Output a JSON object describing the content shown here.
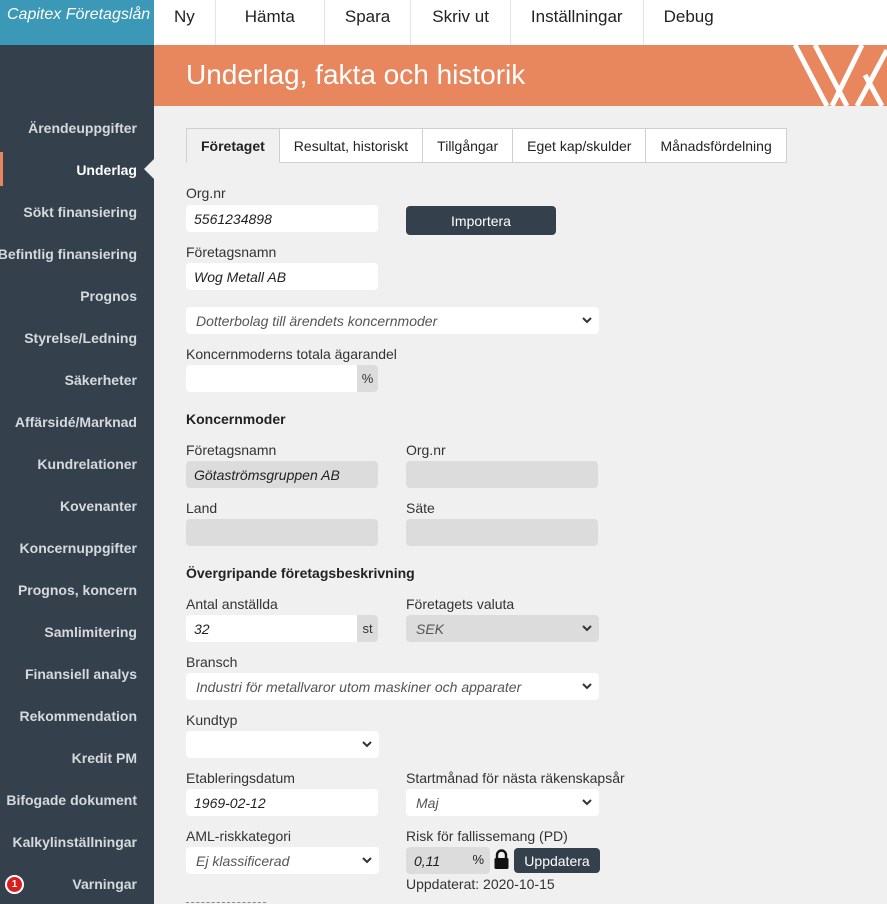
{
  "app": {
    "title": "Capitex Företagslån"
  },
  "topnav": [
    "Ny",
    "Hämta",
    "Spara",
    "Skriv ut",
    "Inställningar",
    "Debug"
  ],
  "sidebar": {
    "items": [
      "Ärendeuppgifter",
      "Underlag",
      "Sökt finansiering",
      "Befintlig finansiering",
      "Prognos",
      "Styrelse/Ledning",
      "Säkerheter",
      "Affärsidé/Marknad",
      "Kundrelationer",
      "Kovenanter",
      "Koncernuppgifter",
      "Prognos, koncern",
      "Samlimitering",
      "Finansiell analys",
      "Rekommendation",
      "Kredit PM",
      "Bifogade dokument",
      "Kalkylinställningar",
      "Varningar"
    ],
    "active": "Underlag",
    "warnings_count": "1"
  },
  "header": {
    "title": "Underlag, fakta och historik"
  },
  "tabs": [
    "Företaget",
    "Resultat, historiskt",
    "Tillgångar",
    "Eget kap/skulder",
    "Månadsfördelning"
  ],
  "form": {
    "orgnr_label": "Org.nr",
    "orgnr_value": "5561234898",
    "import_button": "Importera",
    "company_name_label": "Företagsnamn",
    "company_name_value": "Wog Metall AB",
    "relation_select": "Dotterbolag till ärendets koncernmoder",
    "parent_share_label": "Koncernmoderns totala ägarandel",
    "parent_share_value": "",
    "percent_unit": "%",
    "parent_section": "Koncernmoder",
    "parent_name_label": "Företagsnamn",
    "parent_name_value": "Götaströmsgruppen AB",
    "parent_orgnr_label": "Org.nr",
    "parent_orgnr_value": "",
    "country_label": "Land",
    "country_value": "",
    "seat_label": "Säte",
    "seat_value": "",
    "overview_section": "Övergripande företagsbeskrivning",
    "employees_label": "Antal anställda",
    "employees_value": "32",
    "employees_unit": "st",
    "currency_label": "Företagets valuta",
    "currency_value": "SEK",
    "industry_label": "Bransch",
    "industry_value": "Industri för metallvaror utom maskiner och apparater",
    "customer_type_label": "Kundtyp",
    "customer_type_value": "",
    "established_label": "Etableringsdatum",
    "established_value": "1969-02-12",
    "fiscal_start_label": "Startmånad för nästa räkenskapsår",
    "fiscal_start_value": "Maj",
    "aml_label": "AML-riskkategori",
    "aml_value": "Ej klassificerad",
    "pd_label": "Risk för fallissemang (PD)",
    "pd_value": "0,11",
    "pd_unit": "%",
    "update_button": "Uppdatera",
    "updated_text": "Uppdaterat: 2020-10-15"
  },
  "colors": {
    "accent": "#e8865e",
    "sidebar": "#34414d",
    "brand": "#3b98b6"
  }
}
